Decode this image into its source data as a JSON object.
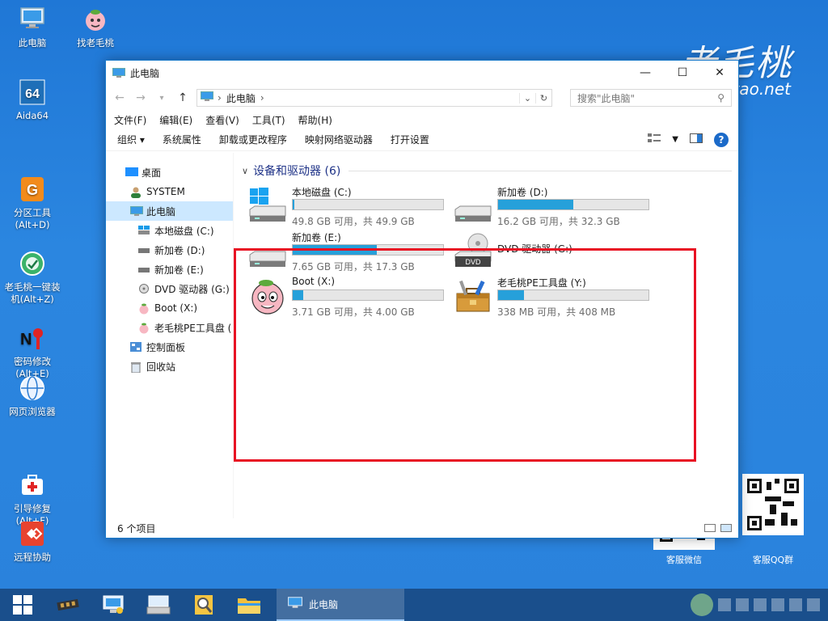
{
  "desktop": {
    "icons": [
      {
        "label": "此电脑"
      },
      {
        "label": "找老毛桃"
      },
      {
        "label": "Aida64"
      },
      {
        "label": "分区工具\n(Alt+D)"
      },
      {
        "label": "老毛桃一键装\n机(Alt+Z)"
      },
      {
        "label": "密码修改\n(Alt+E)"
      },
      {
        "label": "网页浏览器"
      },
      {
        "label": "引导修复\n(Alt+F)"
      },
      {
        "label": "远程协助"
      }
    ],
    "brand": "老毛桃",
    "brand_url": "tao.net",
    "qr_captions": [
      "客服微信",
      "客服QQ群"
    ]
  },
  "window": {
    "title": "此电脑",
    "address": "此电脑",
    "search_placeholder": "搜索\"此电脑\"",
    "menu": [
      "文件(F)",
      "编辑(E)",
      "查看(V)",
      "工具(T)",
      "帮助(H)"
    ],
    "commands": [
      "组织 ▾",
      "系统属性",
      "卸载或更改程序",
      "映射网络驱动器",
      "打开设置"
    ],
    "nav": [
      {
        "label": "桌面",
        "level": 0,
        "icon": "desktop-icon"
      },
      {
        "label": "SYSTEM",
        "level": 1,
        "icon": "user-icon"
      },
      {
        "label": "此电脑",
        "level": 1,
        "icon": "computer-icon",
        "selected": true
      },
      {
        "label": "本地磁盘 (C:)",
        "level": 2,
        "icon": "windows-drive-icon"
      },
      {
        "label": "新加卷 (D:)",
        "level": 2,
        "icon": "drive-icon"
      },
      {
        "label": "新加卷 (E:)",
        "level": 2,
        "icon": "drive-icon"
      },
      {
        "label": "DVD 驱动器 (G:)",
        "level": 2,
        "icon": "dvd-icon"
      },
      {
        "label": "Boot (X:)",
        "level": 2,
        "icon": "peach-icon"
      },
      {
        "label": "老毛桃PE工具盘 (",
        "level": 2,
        "icon": "peach-icon"
      },
      {
        "label": "控制面板",
        "level": 1,
        "icon": "control-panel-icon"
      },
      {
        "label": "回收站",
        "level": 1,
        "icon": "recycle-bin-icon"
      }
    ],
    "group_title": "设备和驱动器 (6)",
    "drives": [
      {
        "name": "本地磁盘 (C:)",
        "detail": "49.8 GB 可用，共 49.9 GB",
        "used_fraction": 0.01,
        "icon": "windows-drive-icon"
      },
      {
        "name": "新加卷 (D:)",
        "detail": "16.2 GB 可用，共 32.3 GB",
        "used_fraction": 0.5,
        "icon": "drive-icon"
      },
      {
        "name": "新加卷 (E:)",
        "detail": "7.65 GB 可用，共 17.3 GB",
        "used_fraction": 0.56,
        "icon": "drive-icon"
      },
      {
        "name": "DVD 驱动器 (G:)",
        "detail": "",
        "used_fraction": null,
        "icon": "dvd-icon"
      },
      {
        "name": "Boot (X:)",
        "detail": "3.71 GB 可用，共 4.00 GB",
        "used_fraction": 0.07,
        "icon": "peach-icon"
      },
      {
        "name": "老毛桃PE工具盘 (Y:)",
        "detail": "338 MB 可用，共 408 MB",
        "used_fraction": 0.17,
        "icon": "toolbox-icon"
      }
    ],
    "status_text": "6 个项目"
  },
  "taskbar": {
    "active_app": "此电脑"
  },
  "colors": {
    "accent": "#26a0da",
    "highlight": "#e81123",
    "group_title": "#1e3287"
  }
}
